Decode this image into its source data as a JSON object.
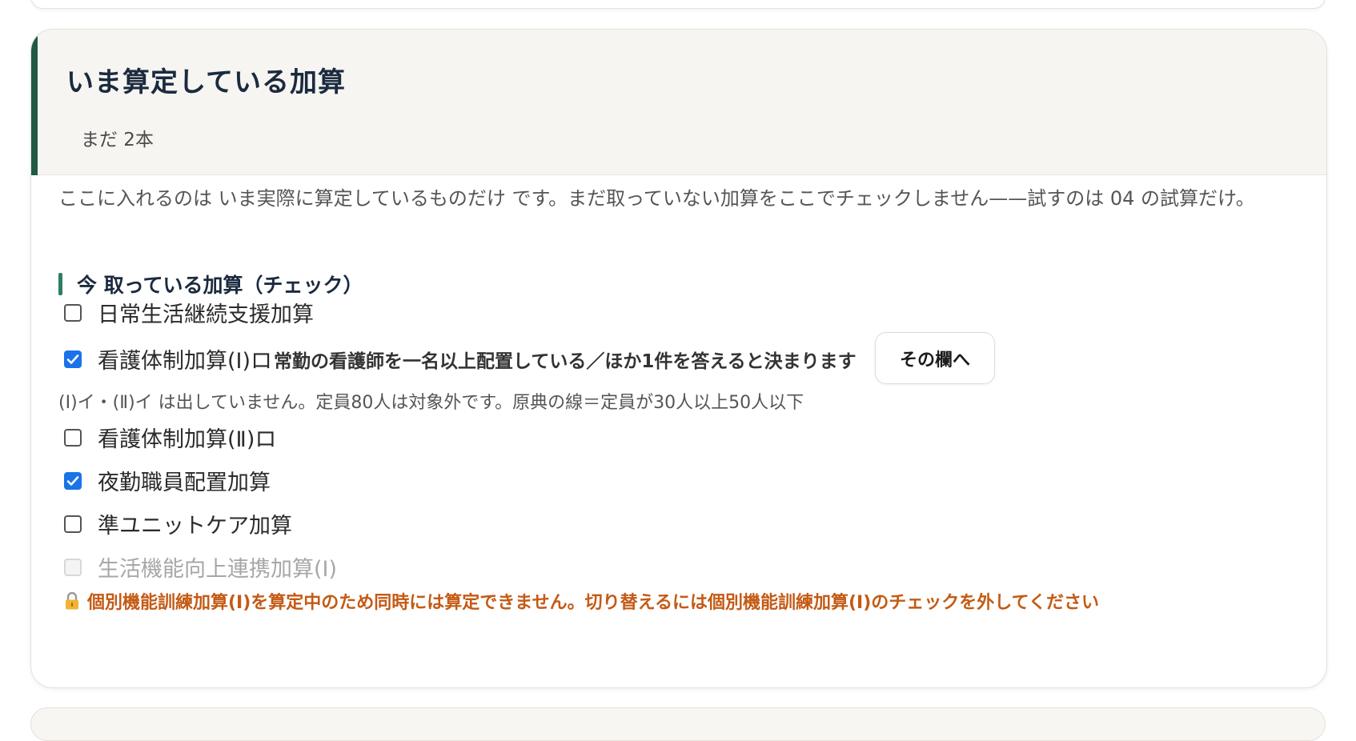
{
  "card": {
    "title": "いま算定している加算",
    "subtitle": "まだ 2本",
    "intro": "ここに入れるのは いま実際に算定しているものだけ です。まだ取っていない加算をここでチェックしません——試すのは 04 の試算だけ。"
  },
  "section": {
    "label": "今 取っている加算（チェック）"
  },
  "options": [
    {
      "label": "日常生活継続支援加算",
      "checked": false,
      "disabled": false
    },
    {
      "label": "看護体制加算(Ⅰ)ロ",
      "hint": "常勤の看護師を一名以上配置している／ほか1件を答えると決まります",
      "checked": true,
      "disabled": false
    },
    {
      "label": "看護体制加算(Ⅱ)ロ",
      "checked": false,
      "disabled": false
    },
    {
      "label": "夜勤職員配置加算",
      "checked": true,
      "disabled": false
    },
    {
      "label": "準ユニットケア加算",
      "checked": false,
      "disabled": false
    },
    {
      "label": "生活機能向上連携加算(Ⅰ)",
      "checked": false,
      "disabled": true
    }
  ],
  "goto_button": {
    "label": "その欄へ"
  },
  "note": "(Ⅰ)イ・(Ⅱ)イ は出していません。定員80人は対象外です。原典の線＝定員が30人以上50人以下",
  "lock_note": {
    "icon": "lock-icon",
    "text": "個別機能訓練加算(Ⅰ)を算定中のため同時には算定できません。切り替えるには個別機能訓練加算(Ⅰ)のチェックを外してください"
  },
  "colors": {
    "accent": "#1f5a45",
    "checkbox": "#1a73e8",
    "warning": "#c45a14"
  }
}
